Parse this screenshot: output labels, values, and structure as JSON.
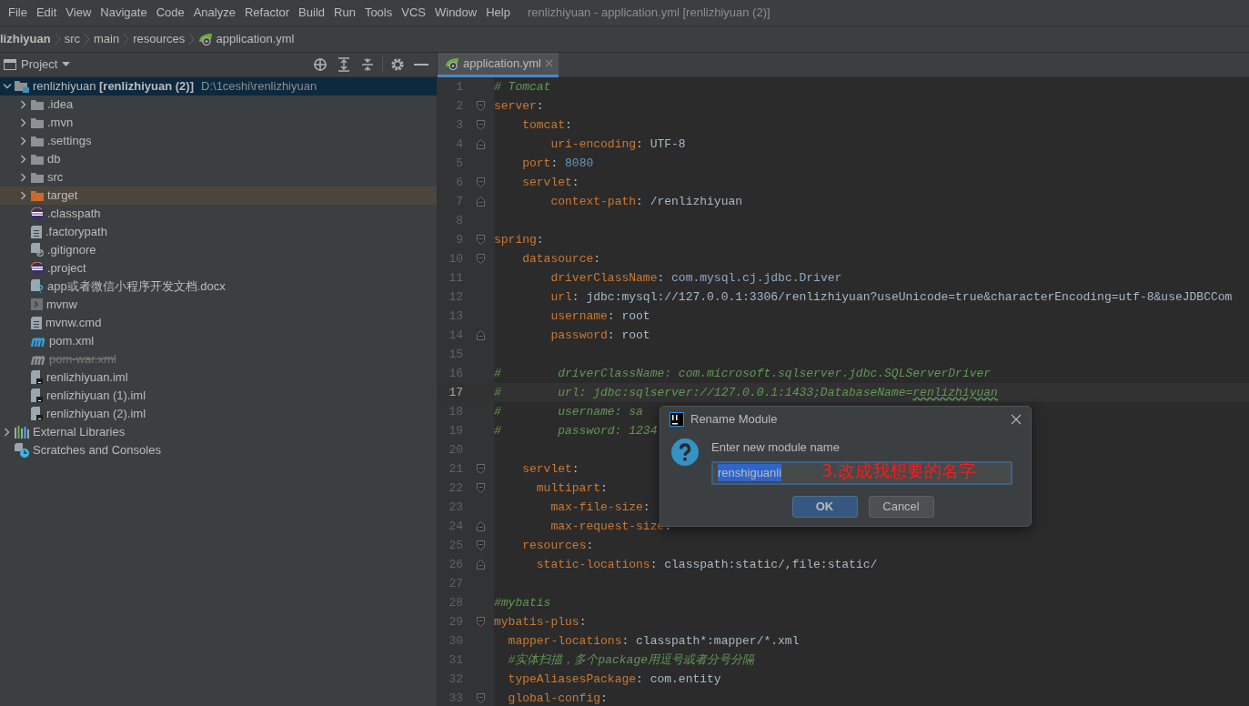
{
  "menu_bar": {
    "items": [
      "File",
      "Edit",
      "View",
      "Navigate",
      "Code",
      "Analyze",
      "Refactor",
      "Build",
      "Run",
      "Tools",
      "VCS",
      "Window",
      "Help"
    ],
    "title": "renlizhiyuan - application.yml [renlizhiyuan (2)]"
  },
  "breadcrumb": [
    {
      "label": "lizhiyuan",
      "kind": "module"
    },
    {
      "label": "src",
      "kind": "dir"
    },
    {
      "label": "main",
      "kind": "dir"
    },
    {
      "label": "resources",
      "kind": "dir"
    },
    {
      "label": "application.yml",
      "kind": "yaml"
    }
  ],
  "project_panel": {
    "title": "Project",
    "tree": [
      {
        "label": "renlizhiyuan **[renlizhiyuan (2)]**",
        "path": "D:\\1ceshi\\renlizhiyuan",
        "kind": "module",
        "expanded": true,
        "selected": true,
        "hovered": false,
        "ignored": false,
        "children": [
          {
            "label": ".idea",
            "kind": "folder",
            "expanded": false,
            "selected": false,
            "hovered": false,
            "ignored": false
          },
          {
            "label": ".mvn",
            "kind": "folder",
            "expanded": false,
            "selected": false,
            "hovered": false,
            "ignored": false
          },
          {
            "label": ".settings",
            "kind": "folder",
            "expanded": false,
            "selected": false,
            "hovered": false,
            "ignored": false
          },
          {
            "label": "db",
            "kind": "folder",
            "expanded": false,
            "selected": false,
            "hovered": false,
            "ignored": false
          },
          {
            "label": "src",
            "kind": "folder",
            "expanded": false,
            "selected": false,
            "hovered": false,
            "ignored": false
          },
          {
            "label": "target",
            "kind": "excluded-folder",
            "expanded": false,
            "selected": false,
            "hovered": true,
            "ignored": false
          },
          {
            "label": ".classpath",
            "kind": "eclipse",
            "selected": false,
            "hovered": false,
            "ignored": false
          },
          {
            "label": ".factorypath",
            "kind": "text",
            "selected": false,
            "hovered": false,
            "ignored": false
          },
          {
            "label": ".gitignore",
            "kind": "gitignore",
            "selected": false,
            "hovered": false,
            "ignored": false
          },
          {
            "label": ".project",
            "kind": "eclipse",
            "selected": false,
            "hovered": false,
            "ignored": false
          },
          {
            "label": "app或者微信小程序开发文档.docx",
            "kind": "unknown",
            "selected": false,
            "hovered": false,
            "ignored": false
          },
          {
            "label": "mvnw",
            "kind": "script",
            "selected": false,
            "hovered": false,
            "ignored": false
          },
          {
            "label": "mvnw.cmd",
            "kind": "text",
            "selected": false,
            "hovered": false,
            "ignored": false
          },
          {
            "label": "pom.xml",
            "kind": "maven",
            "selected": false,
            "hovered": false,
            "ignored": false
          },
          {
            "label": "pom-war.xml",
            "kind": "maven",
            "selected": false,
            "hovered": false,
            "ignored": true
          },
          {
            "label": "renlizhiyuan.iml",
            "kind": "iml",
            "selected": false,
            "hovered": false,
            "ignored": false
          },
          {
            "label": "renlizhiyuan (1).iml",
            "kind": "iml",
            "selected": false,
            "hovered": false,
            "ignored": false
          },
          {
            "label": "renlizhiyuan (2).iml",
            "kind": "iml",
            "selected": false,
            "hovered": false,
            "ignored": false
          }
        ]
      },
      {
        "label": "External Libraries",
        "kind": "libraries",
        "expanded": false,
        "selected": false,
        "hovered": false,
        "ignored": false
      },
      {
        "label": "Scratches and Consoles",
        "kind": "scratches",
        "selected": false,
        "hovered": false,
        "ignored": false
      }
    ]
  },
  "editor": {
    "tabs": [
      {
        "label": "application.yml",
        "selected": true
      }
    ],
    "lines": [
      {
        "number": "1",
        "current": false,
        "fold_start": false,
        "fold_end": false,
        "tokens": [
          {
            "kind": "comment",
            "text": "# Tomcat"
          }
        ]
      },
      {
        "number": "2",
        "current": false,
        "fold_start": true,
        "fold_end": false,
        "tokens": [
          {
            "kind": "key",
            "text": "server"
          },
          {
            "kind": "plain",
            "text": ":"
          }
        ]
      },
      {
        "number": "3",
        "current": false,
        "fold_start": true,
        "fold_end": false,
        "tokens": [
          {
            "kind": "key",
            "text": "    tomcat"
          },
          {
            "kind": "plain",
            "text": ":"
          }
        ]
      },
      {
        "number": "4",
        "current": false,
        "fold_start": false,
        "fold_end": true,
        "tokens": [
          {
            "kind": "key",
            "text": "        uri-encoding"
          },
          {
            "kind": "plain",
            "text": ": UTF-8"
          }
        ]
      },
      {
        "number": "5",
        "current": false,
        "fold_start": false,
        "fold_end": false,
        "tokens": [
          {
            "kind": "key",
            "text": "    port"
          },
          {
            "kind": "plain",
            "text": ": "
          },
          {
            "kind": "number",
            "text": "8080"
          }
        ]
      },
      {
        "number": "6",
        "current": false,
        "fold_start": true,
        "fold_end": false,
        "tokens": [
          {
            "kind": "key",
            "text": "    servlet"
          },
          {
            "kind": "plain",
            "text": ":"
          }
        ]
      },
      {
        "number": "7",
        "current": false,
        "fold_start": false,
        "fold_end": true,
        "tokens": [
          {
            "kind": "key",
            "text": "        context-path"
          },
          {
            "kind": "plain",
            "text": ": /renlizhiyuan"
          }
        ]
      },
      {
        "number": "8",
        "current": false,
        "fold_start": false,
        "fold_end": false
      },
      {
        "number": "9",
        "current": false,
        "fold_start": true,
        "fold_end": false,
        "tokens": [
          {
            "kind": "key",
            "text": "spring"
          },
          {
            "kind": "plain",
            "text": ":"
          }
        ]
      },
      {
        "number": "10",
        "current": false,
        "fold_start": true,
        "fold_end": false,
        "tokens": [
          {
            "kind": "key",
            "text": "    datasource"
          },
          {
            "kind": "plain",
            "text": ":"
          }
        ]
      },
      {
        "number": "11",
        "current": false,
        "fold_start": false,
        "fold_end": false,
        "tokens": [
          {
            "kind": "key",
            "text": "        driverClassName"
          },
          {
            "kind": "plain",
            "text": ": "
          },
          {
            "kind": "ref",
            "text": "com.mysql.cj.jdbc.Driver"
          }
        ]
      },
      {
        "number": "12",
        "current": false,
        "fold_start": false,
        "fold_end": false,
        "tokens": [
          {
            "kind": "key",
            "text": "        url"
          },
          {
            "kind": "plain",
            "text": ": jdbc:mysql://127.0.0.1:3306/renlizhiyuan?useUnicode=true&characterEncoding=utf-8&useJDBCCom"
          }
        ]
      },
      {
        "number": "13",
        "current": false,
        "fold_start": false,
        "fold_end": false,
        "tokens": [
          {
            "kind": "key",
            "text": "        username"
          },
          {
            "kind": "plain",
            "text": ": root"
          }
        ]
      },
      {
        "number": "14",
        "current": false,
        "fold_start": false,
        "fold_end": true,
        "tokens": [
          {
            "kind": "key",
            "text": "        password"
          },
          {
            "kind": "plain",
            "text": ": root"
          }
        ]
      },
      {
        "number": "15",
        "current": false,
        "fold_start": false,
        "fold_end": false
      },
      {
        "number": "16",
        "current": false,
        "fold_start": false,
        "fold_end": false,
        "tokens": [
          {
            "kind": "comment",
            "text": "#        driverClassName: com.microsoft.sqlserver.jdbc.SQLServerDriver"
          }
        ]
      },
      {
        "number": "17",
        "current": true,
        "fold_start": false,
        "fold_end": false,
        "tokens": [
          {
            "kind": "comment",
            "text": "#        url: jdbc:sqlserver://127.0.0.1:1433;DatabaseName="
          },
          {
            "kind": "typo",
            "text": "renlizhiyuan"
          }
        ]
      },
      {
        "number": "18",
        "current": false,
        "fold_start": false,
        "fold_end": false,
        "tokens": [
          {
            "kind": "comment",
            "text": "#        username: sa"
          }
        ]
      },
      {
        "number": "19",
        "current": false,
        "fold_start": false,
        "fold_end": false,
        "tokens": [
          {
            "kind": "comment",
            "text": "#        password: 1234"
          }
        ]
      },
      {
        "number": "20",
        "current": false,
        "fold_start": false,
        "fold_end": false
      },
      {
        "number": "21",
        "current": false,
        "fold_start": true,
        "fold_end": false,
        "tokens": [
          {
            "kind": "key",
            "text": "    servlet"
          },
          {
            "kind": "plain",
            "text": ":"
          }
        ]
      },
      {
        "number": "22",
        "current": false,
        "fold_start": true,
        "fold_end": false,
        "tokens": [
          {
            "kind": "key",
            "text": "      multipart"
          },
          {
            "kind": "plain",
            "text": ":"
          }
        ]
      },
      {
        "number": "23",
        "current": false,
        "fold_start": false,
        "fold_end": false,
        "tokens": [
          {
            "kind": "key",
            "text": "        max-file-size"
          },
          {
            "kind": "plain",
            "text": ":"
          }
        ]
      },
      {
        "number": "24",
        "current": false,
        "fold_start": false,
        "fold_end": true,
        "tokens": [
          {
            "kind": "key",
            "text": "        max-request-size"
          },
          {
            "kind": "plain",
            "text": ":"
          }
        ]
      },
      {
        "number": "25",
        "current": false,
        "fold_start": true,
        "fold_end": false,
        "tokens": [
          {
            "kind": "key",
            "text": "    resources"
          },
          {
            "kind": "plain",
            "text": ":"
          }
        ]
      },
      {
        "number": "26",
        "current": false,
        "fold_start": false,
        "fold_end": true,
        "tokens": [
          {
            "kind": "key",
            "text": "      static-locations"
          },
          {
            "kind": "plain",
            "text": ": classpath:static/,file:static/"
          }
        ]
      },
      {
        "number": "27",
        "current": false,
        "fold_start": false,
        "fold_end": false
      },
      {
        "number": "28",
        "current": false,
        "fold_start": false,
        "fold_end": false,
        "tokens": [
          {
            "kind": "comment",
            "text": "#mybatis"
          }
        ]
      },
      {
        "number": "29",
        "current": false,
        "fold_start": true,
        "fold_end": false,
        "tokens": [
          {
            "kind": "key",
            "text": "mybatis-plus"
          },
          {
            "kind": "plain",
            "text": ":"
          }
        ]
      },
      {
        "number": "30",
        "current": false,
        "fold_start": false,
        "fold_end": false,
        "tokens": [
          {
            "kind": "key",
            "text": "  mapper-locations"
          },
          {
            "kind": "plain",
            "text": ": classpath*:mapper/*.xml"
          }
        ]
      },
      {
        "number": "31",
        "current": false,
        "fold_start": false,
        "fold_end": false,
        "tokens": [
          {
            "kind": "comment",
            "text": "  #实体扫描，多个package用逗号或者分号分隔"
          }
        ]
      },
      {
        "number": "32",
        "current": false,
        "fold_start": false,
        "fold_end": false,
        "tokens": [
          {
            "kind": "key",
            "text": "  typeAliasesPackage"
          },
          {
            "kind": "plain",
            "text": ": com.entity"
          }
        ]
      },
      {
        "number": "33",
        "current": false,
        "fold_start": true,
        "fold_end": false,
        "tokens": [
          {
            "kind": "key",
            "text": "  global-config"
          },
          {
            "kind": "plain",
            "text": ":"
          }
        ]
      }
    ]
  },
  "dialog": {
    "title": "Rename Module",
    "prompt": "Enter new module name",
    "value": "renshiguanli",
    "value_selected": true,
    "annotation": "3.改成我想要的名字",
    "buttons": [
      {
        "label": "OK",
        "default": true
      },
      {
        "label": "Cancel",
        "default": false
      }
    ]
  }
}
